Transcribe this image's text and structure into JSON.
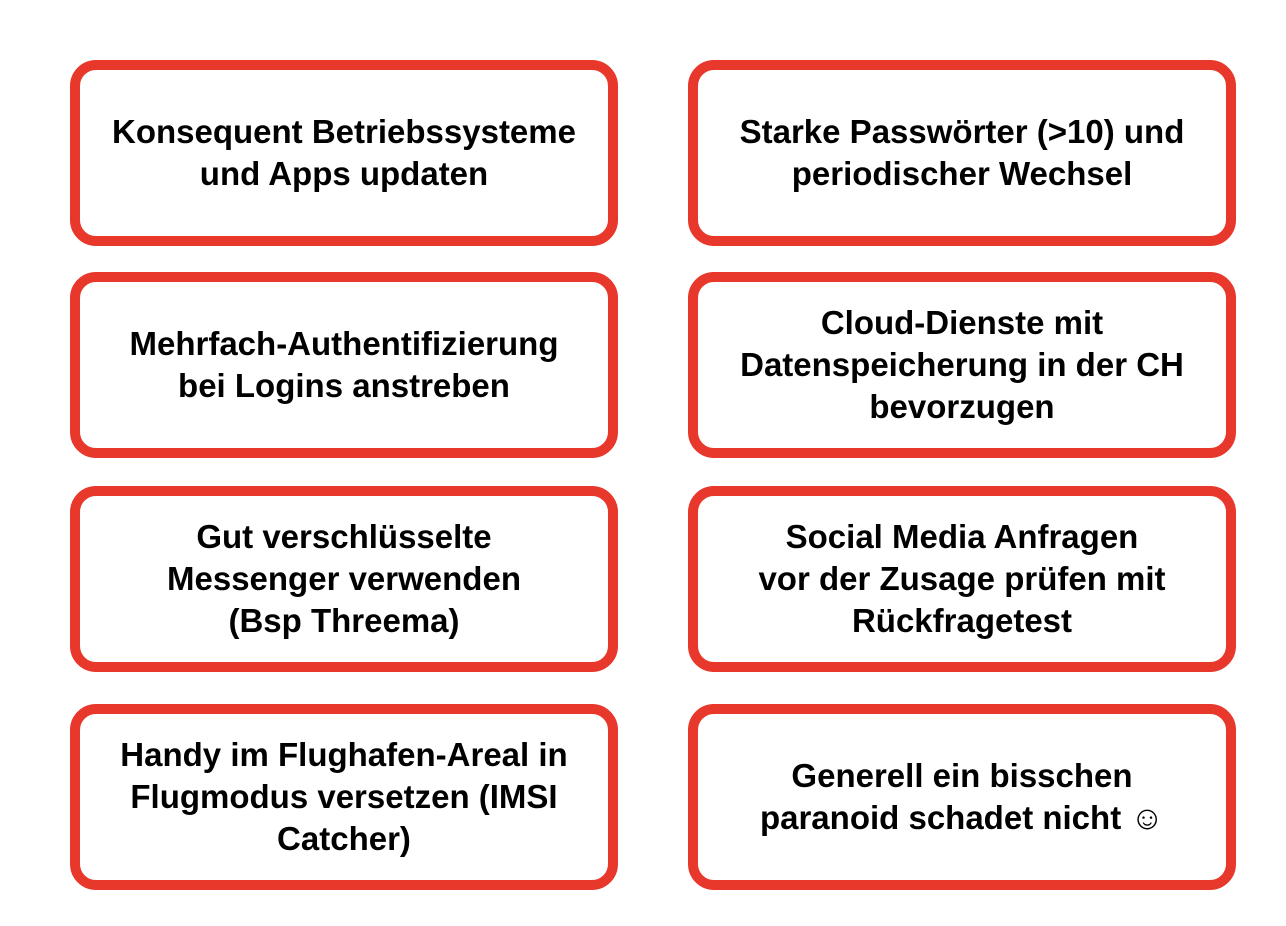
{
  "colors": {
    "border": "#e8382b",
    "text": "#000000",
    "background": "#ffffff"
  },
  "cards": [
    {
      "text": "Konsequent Betriebssysteme\nund Apps updaten"
    },
    {
      "text": "Starke Passwörter (>10) und\nperiodischer Wechsel"
    },
    {
      "text": "Mehrfach-Authentifizierung\nbei Logins anstreben"
    },
    {
      "text": "Cloud-Dienste mit\nDatenspeicherung in der CH\nbevorzugen"
    },
    {
      "text": "Gut verschlüsselte\nMessenger verwenden\n(Bsp Threema)"
    },
    {
      "text": "Social Media Anfragen\nvor der Zusage prüfen mit\nRückfragetest"
    },
    {
      "text": "Handy im Flughafen-Areal in\nFlugmodus versetzen (IMSI\nCatcher)"
    },
    {
      "text": "Generell ein bisschen\nparanoid schadet nicht ☺"
    }
  ]
}
